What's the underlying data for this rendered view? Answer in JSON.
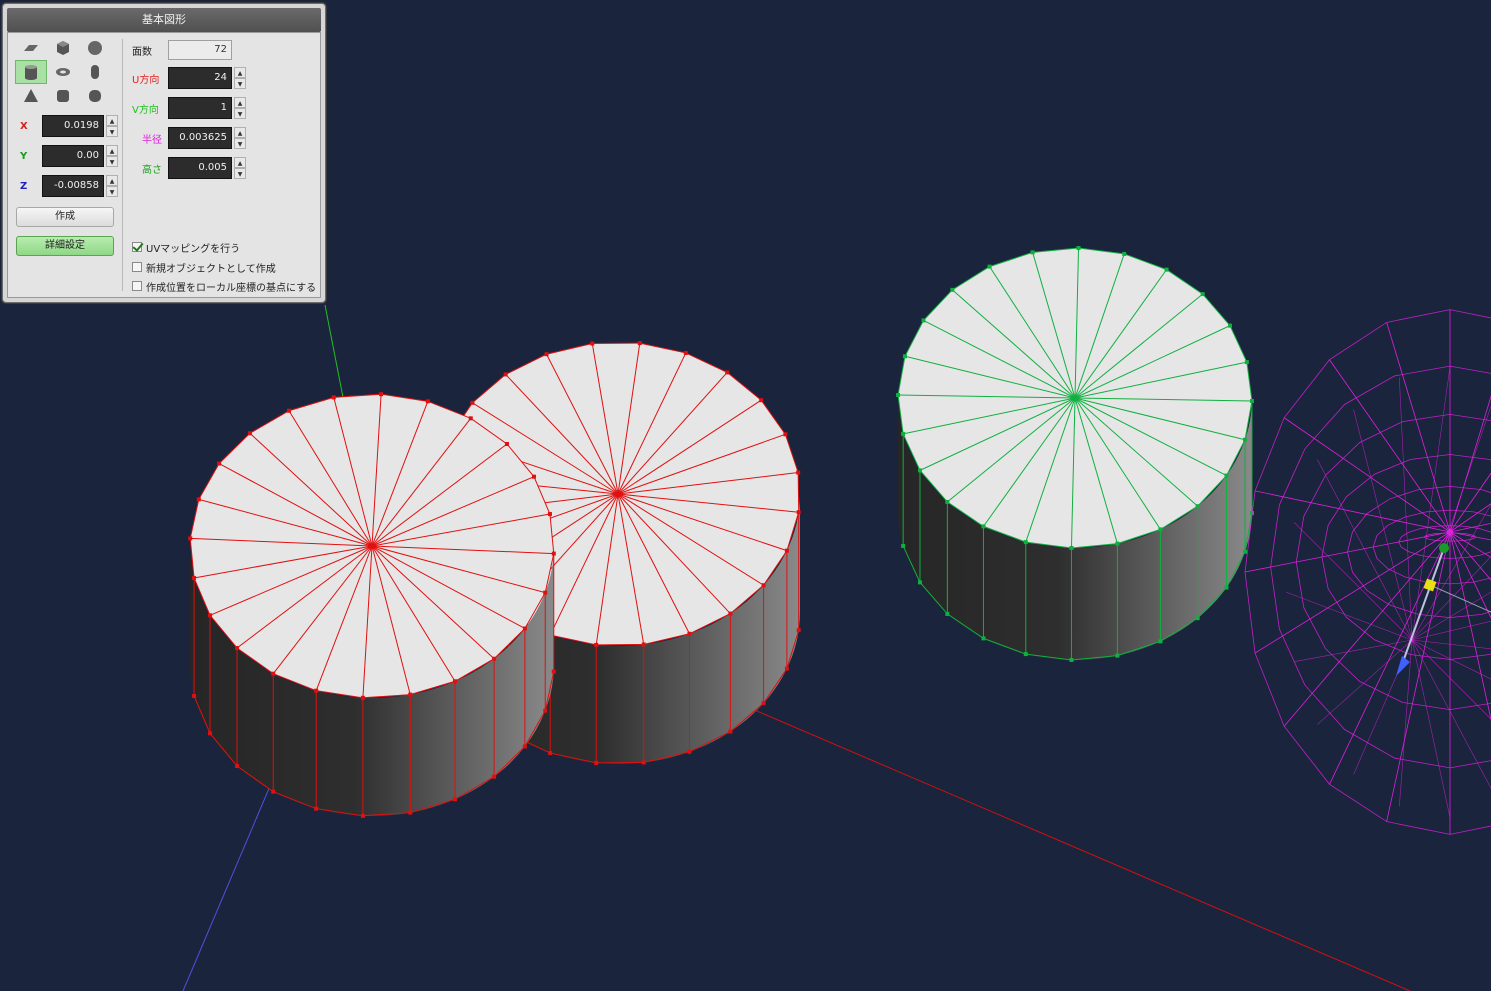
{
  "panel": {
    "title": "基本図形",
    "shapes": [
      {
        "name": "plane-shape-icon",
        "selected": false
      },
      {
        "name": "cube-shape-icon",
        "selected": false
      },
      {
        "name": "sphere-shape-icon",
        "selected": false
      },
      {
        "name": "cylinder-shape-icon",
        "selected": true
      },
      {
        "name": "torus-shape-icon",
        "selected": false
      },
      {
        "name": "capsule-shape-icon",
        "selected": false
      },
      {
        "name": "cone-shape-icon",
        "selected": false
      },
      {
        "name": "rounded-box-shape-icon",
        "selected": false
      },
      {
        "name": "rounded-cylinder-shape-icon",
        "selected": false
      }
    ],
    "position": {
      "x_label": "X",
      "x_value": "0.0198",
      "y_label": "Y",
      "y_value": "0.00",
      "z_label": "Z",
      "z_value": "-0.00858"
    },
    "create_label": "作成",
    "detail_label": "詳細設定",
    "faces_label": "面数",
    "faces_value": "72",
    "u_label": "U方向",
    "u_value": "24",
    "v_label": "V方向",
    "v_value": "1",
    "radius_label": "半径",
    "radius_value": "0.003625",
    "height_label": "高さ",
    "height_value": "0.005",
    "options": {
      "uv_mapping": {
        "label": "UVマッピングを行う",
        "checked": true
      },
      "new_object": {
        "label": "新規オブジェクトとして作成",
        "checked": false
      },
      "local_origin": {
        "label": "作成位置をローカル座標の基点にする",
        "checked": false
      }
    }
  },
  "colors": {
    "background": "#1a243c",
    "selected_edge": "#e01010",
    "new_edge": "#10b040",
    "other_edge": "#e020e0",
    "x_axis": "#d01010",
    "y_axis": "#20c020",
    "z_axis": "#5050e0",
    "x_label": "#d02020",
    "y_label": "#1a9a1a",
    "z_label": "#2020c0",
    "u_label": "#e02020",
    "v_label": "#20c020",
    "radius_label": "#e020e0",
    "height_label": "#1aa01a"
  }
}
